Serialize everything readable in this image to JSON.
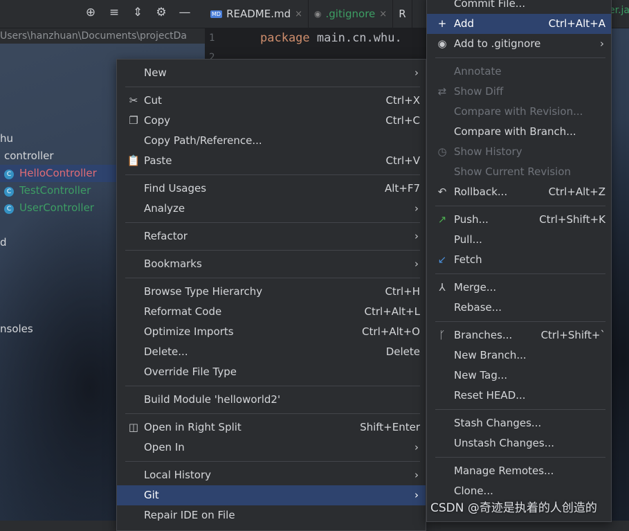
{
  "toolbar": {
    "icons": [
      "crosshair-icon",
      "expand-all-icon",
      "collapse-all-icon",
      "gear-icon",
      "minimize-icon"
    ],
    "icon_glyphs": [
      "⊕",
      "≡",
      "⇕",
      "⚙",
      "—"
    ]
  },
  "tabs": [
    {
      "label": "README.md",
      "close": "×"
    },
    {
      "label": ".gitignore",
      "close": "×"
    },
    {
      "label": "R"
    }
  ],
  "right_tab_fragment": "er.ja",
  "path": "Users\\hanzhuan\\Documents\\projectDa",
  "editor": {
    "line_numbers": [
      "1",
      "2"
    ],
    "keyword": "package",
    "code": " main.cn.whu."
  },
  "tree": {
    "item_hu": "hu",
    "controller": "controller",
    "classes": [
      {
        "name": "HelloController",
        "color": "#e06c75"
      },
      {
        "name": "TestController",
        "color": "#3d9e64"
      },
      {
        "name": "UserController",
        "color": "#3d9e64"
      }
    ],
    "item_d": "d",
    "consoles": "nsoles"
  },
  "menu1": {
    "new": "New",
    "cut": "Cut",
    "cut_sc": "Ctrl+X",
    "copy": "Copy",
    "copy_sc": "Ctrl+C",
    "copy_path": "Copy Path/Reference...",
    "paste": "Paste",
    "paste_sc": "Ctrl+V",
    "find_usages": "Find Usages",
    "find_usages_sc": "Alt+F7",
    "analyze": "Analyze",
    "refactor": "Refactor",
    "bookmarks": "Bookmarks",
    "browse_type": "Browse Type Hierarchy",
    "browse_type_sc": "Ctrl+H",
    "reformat": "Reformat Code",
    "reformat_sc": "Ctrl+Alt+L",
    "optimize": "Optimize Imports",
    "optimize_sc": "Ctrl+Alt+O",
    "delete": "Delete...",
    "delete_sc": "Delete",
    "override": "Override File Type",
    "build_module": "Build Module 'helloworld2'",
    "open_right": "Open in Right Split",
    "open_right_sc": "Shift+Enter",
    "open_in": "Open In",
    "local_history": "Local History",
    "git": "Git",
    "repair": "Repair IDE on File",
    "arrow": "›"
  },
  "menu2": {
    "commit_file": "Commit File...",
    "add": "Add",
    "add_sc": "Ctrl+Alt+A",
    "add_gitignore": "Add to .gitignore",
    "annotate": "Annotate",
    "show_diff": "Show Diff",
    "compare_revision": "Compare with Revision...",
    "compare_branch": "Compare with Branch...",
    "show_history": "Show History",
    "show_current": "Show Current Revision",
    "rollback": "Rollback...",
    "rollback_sc": "Ctrl+Alt+Z",
    "push": "Push...",
    "push_sc": "Ctrl+Shift+K",
    "pull": "Pull...",
    "fetch": "Fetch",
    "merge": "Merge...",
    "rebase": "Rebase...",
    "branches": "Branches...",
    "branches_sc": "Ctrl+Shift+`",
    "new_branch": "New Branch...",
    "new_tag": "New Tag...",
    "reset_head": "Reset HEAD...",
    "stash": "Stash Changes...",
    "unstash": "Unstash Changes...",
    "manage_remotes": "Manage Remotes...",
    "clone": "Clone...",
    "arrow": "›"
  },
  "watermark": "CSDN @奇迹是执着的人创造的",
  "colors": {
    "selection": "#2e436e",
    "menu_bg": "#2b2d30",
    "push_icon": "#4caf50",
    "fetch_icon": "#4a8fd8"
  }
}
